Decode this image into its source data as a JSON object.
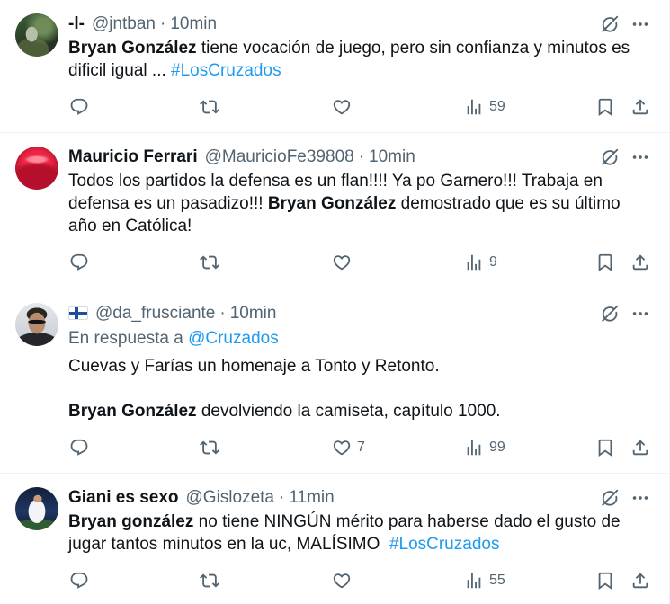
{
  "separator": "·",
  "colors": {
    "text": "#0f1419",
    "secondary": "#536471",
    "link": "#1d9bf0",
    "divider": "#eff3f4"
  },
  "icons": {
    "header": [
      "grok-icon",
      "more-icon"
    ],
    "actions": [
      "reply-icon",
      "retweet-icon",
      "like-icon",
      "views-icon",
      "bookmark-icon",
      "share-icon"
    ]
  },
  "tweets": [
    {
      "name": "-l-",
      "handle": "@jntban",
      "time": "10min",
      "lines": [
        [
          "Bryan González",
          " tiene vocación de juego, pero sin confianza y minutos es"
        ],
        [
          "dificil igual ... ",
          "#LosCruzados"
        ]
      ],
      "stats": {
        "views": "59"
      }
    },
    {
      "name": "Mauricio Ferrari",
      "handle": "@MauricioFe39808",
      "time": "10min",
      "lines": [
        [
          "Todos los partidos la defensa es un flan!!!! Ya po Garnero!!! Trabaja en"
        ],
        [
          "defensa es un pasadizo!!! ",
          "Bryan González",
          " demostrado que es su último"
        ],
        [
          "año en Católica!"
        ]
      ],
      "stats": {
        "views": "9"
      }
    },
    {
      "name_icon": "finland-flag-icon",
      "handle": "@da_frusciante",
      "time": "10min",
      "reply_to": {
        "prefix": "En respuesta a ",
        "mention": "@Cruzados"
      },
      "lines": [
        [
          "Cuevas y Farías un homenaje a Tonto y Retonto."
        ],
        [],
        [
          "Bryan González",
          " devolviendo la camiseta, capítulo 1000."
        ]
      ],
      "stats": {
        "likes": "7",
        "views": "99"
      }
    },
    {
      "name": "Giani es sexo",
      "handle": "@Gislozeta",
      "time": "11min",
      "lines": [
        [
          "Bryan gonzález",
          " no tiene NINGÚN mérito para haberse dado el gusto de"
        ],
        [
          "jugar tantos minutos en la uc, MALÍSIMO  ",
          "#LosCruzados"
        ]
      ],
      "stats": {
        "views": "55"
      }
    }
  ]
}
